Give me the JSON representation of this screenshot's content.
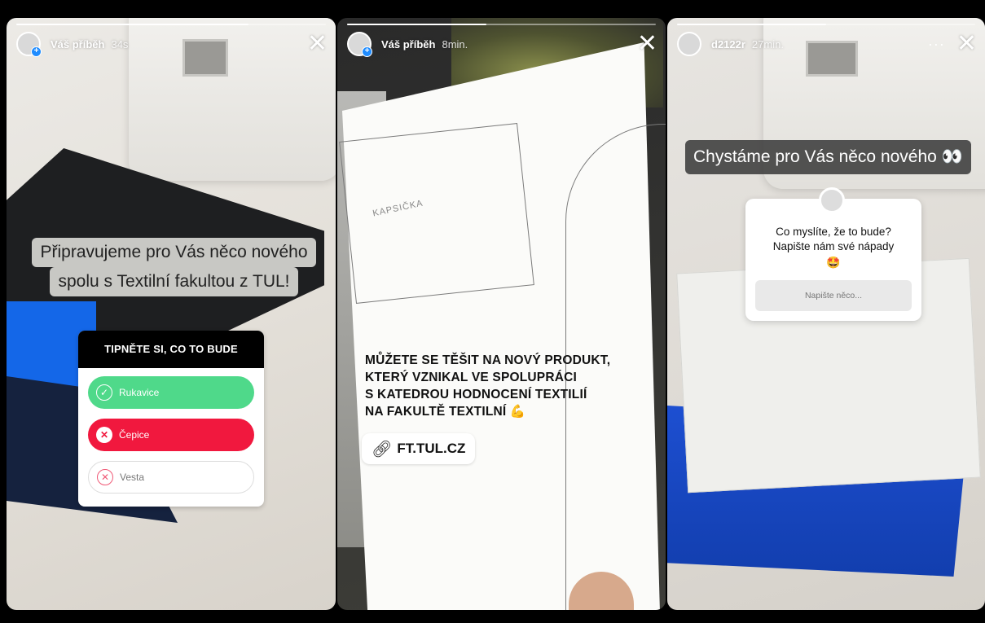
{
  "stories": [
    {
      "username": "Váš příběh",
      "time": "34s",
      "progress": 0.75,
      "caption_lines": [
        "Připravujeme pro Vás něco nového",
        "spolu s Textilní fakultou z TUL!"
      ],
      "quiz": {
        "title": "TIPNĚTE SI, CO TO BUDE",
        "options": [
          {
            "label": "Rukavice",
            "state": "correct"
          },
          {
            "label": "Čepice",
            "state": "wrong"
          },
          {
            "label": "Vesta",
            "state": "neutral"
          }
        ]
      }
    },
    {
      "username": "Váš příběh",
      "time": "8min.",
      "progress": 0.45,
      "sketch_label": "KAPSIČKA",
      "caption_lines": [
        "MŮŽETE SE TĚŠIT NA NOVÝ PRODUKT,",
        "KTERÝ VZNIKAL VE SPOLUPRÁCI",
        "S KATEDROU HODNOCENÍ TEXTILIÍ",
        "NA FAKULTĚ TEXTILNÍ 💪"
      ],
      "link": {
        "icon": "link-icon",
        "label": "FT.TUL.CZ"
      }
    },
    {
      "username": "d2122r",
      "time": "27min.",
      "progress": 0.5,
      "caption": "Chystáme pro Vás něco nového 👀",
      "question": {
        "text_lines": [
          "Co myslíte, že to bude?",
          "Napište nám své nápady"
        ],
        "emoji": "🤩",
        "placeholder": "Napište něco..."
      }
    }
  ],
  "icons": {
    "close": "close-icon",
    "more": "more-icon",
    "check": "check-icon",
    "cross": "cross-icon"
  },
  "colors": {
    "correct": "#4fd98a",
    "wrong": "#f1183e",
    "fabric_blue": "#1d4fd1"
  }
}
